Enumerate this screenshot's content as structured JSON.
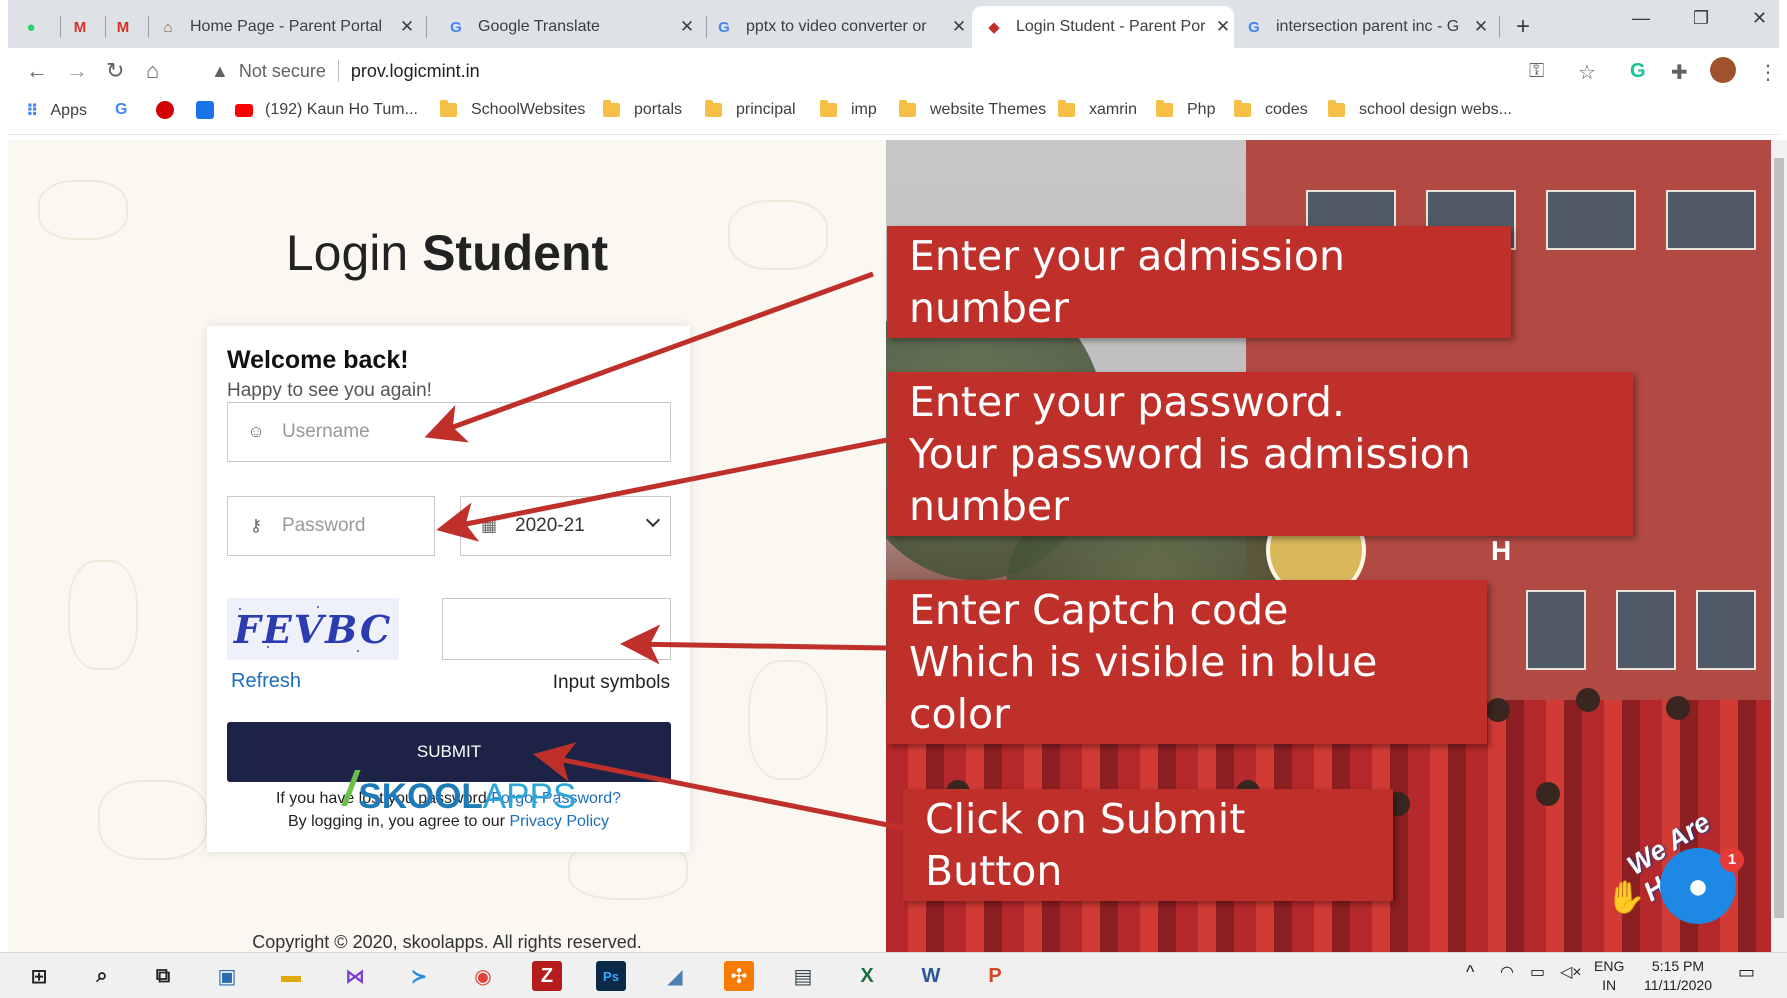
{
  "browser": {
    "tabs": [
      {
        "title": "Home Page - Parent Portal"
      },
      {
        "title": "Google Translate"
      },
      {
        "title": "pptx to video converter or"
      },
      {
        "title": "Login Student - Parent Por"
      },
      {
        "title": "intersection parent inc - G"
      }
    ],
    "new_tab": "+",
    "address": {
      "security": "Not secure",
      "url": "prov.logicmint.in"
    },
    "bookmarks": [
      "Apps",
      "(192) Kaun Ho Tum...",
      "SchoolWebsites",
      "portals",
      "principal",
      "imp",
      "website Themes",
      "xamrin",
      "Php",
      "codes",
      "school design webs..."
    ]
  },
  "login": {
    "title_light": "Login",
    "title_bold": "Student",
    "welcome": "Welcome back!",
    "subtitle": "Happy to see you again!",
    "username_placeholder": "Username",
    "password_placeholder": "Password",
    "session": "2020-21",
    "captcha_text": "FEVBC",
    "refresh": "Refresh",
    "input_symbols": "Input symbols",
    "submit": "SUBMIT",
    "lost_password_text": "If you have lost you password",
    "forgot_link": "Forgot Password?",
    "agree_text": "By logging in, you agree to our",
    "privacy_link": "Privacy Policy",
    "logo_main": "SKOOL",
    "logo_apps": "APPS",
    "copyright": "Copyright © 2020, skoolapps. All rights reserved."
  },
  "callouts": {
    "admission": "Enter your admission number",
    "password_line1": "Enter your password.",
    "password_line2": "Your password is admission number",
    "captcha_line1": "Enter Captch code",
    "captcha_line2": "Which is visible in blue color",
    "submit": "Click on Submit Button"
  },
  "photo": {
    "building_letter": "H"
  },
  "chat": {
    "label": "We Are Here!",
    "badge": "1"
  },
  "taskbar": {
    "lang_top": "ENG",
    "lang_bottom": "IN",
    "time": "5:15 PM",
    "date": "11/11/2020"
  },
  "colors": {
    "callout": "#c0302b",
    "submit_bg": "#1d2347",
    "link": "#1c6dbb",
    "captcha": "#2b3cb0"
  }
}
